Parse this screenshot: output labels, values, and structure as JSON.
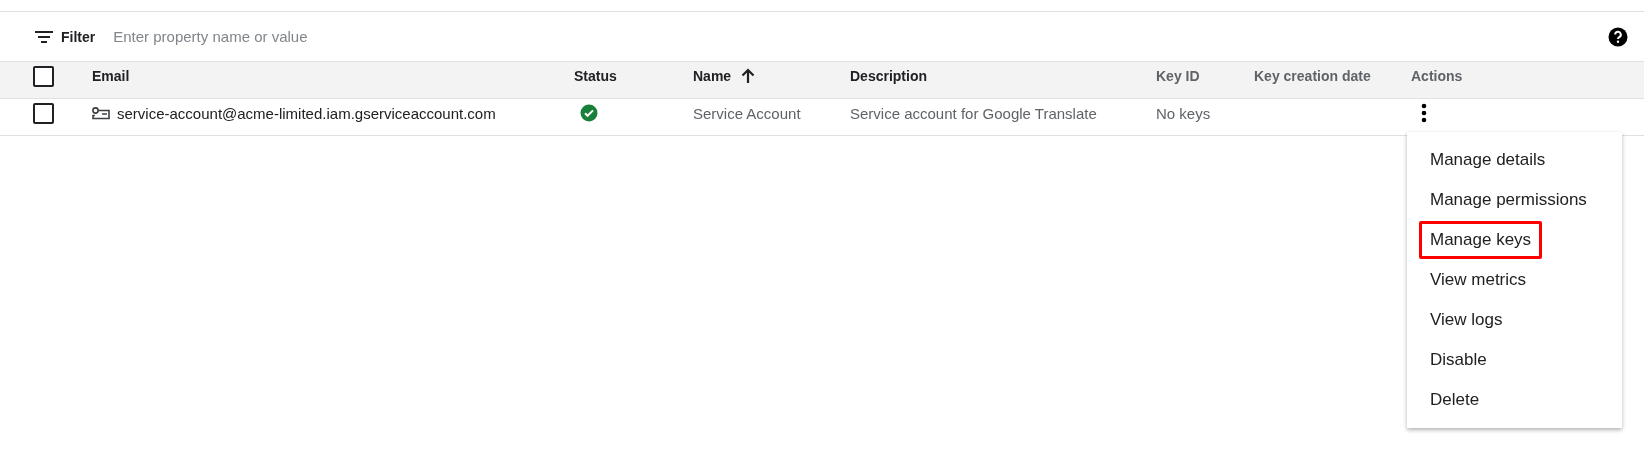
{
  "filter": {
    "label": "Filter",
    "placeholder": "Enter property name or value"
  },
  "table": {
    "select_all": {
      "checked": false
    },
    "columns": [
      {
        "label": "Email",
        "sortable": true,
        "sorted": false
      },
      {
        "label": "Status",
        "sortable": true,
        "sorted": false
      },
      {
        "label": "Name",
        "sortable": true,
        "sorted": true
      },
      {
        "label": "Description",
        "sortable": true,
        "sorted": false
      },
      {
        "label": "Key ID",
        "sortable": false,
        "sorted": false
      },
      {
        "label": "Key creation date",
        "sortable": false,
        "sorted": false
      },
      {
        "label": "Actions",
        "sortable": false,
        "sorted": false
      }
    ],
    "rows": [
      {
        "checked": false,
        "email": "service-account@acme-limited.iam.gserviceaccount.com",
        "enabled": true,
        "name": "Service Account",
        "description": "Service account for Google Translate",
        "key_id": "No keys"
      }
    ]
  },
  "actions_menu": {
    "items": [
      {
        "label": "Manage details",
        "highlighted": false
      },
      {
        "label": "Manage permissions",
        "highlighted": false
      },
      {
        "label": "Manage keys",
        "highlighted": true
      },
      {
        "label": "View metrics",
        "highlighted": false
      },
      {
        "label": "View logs",
        "highlighted": false
      },
      {
        "label": "Disable",
        "highlighted": false
      },
      {
        "label": "Delete",
        "highlighted": false
      }
    ]
  }
}
